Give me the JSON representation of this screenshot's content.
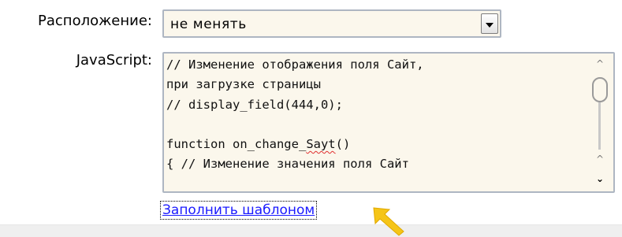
{
  "form": {
    "location_label": "Расположение:",
    "location_value": "не менять",
    "javascript_label": "JavaScript:",
    "code_lines": [
      "// Изменение отображения поля Сайт,",
      "при загрузке страницы",
      "// display_field(444,0);",
      "",
      "function on_change_Sayt()",
      "{ // Изменение значения поля Сайт"
    ],
    "fill_template_link": "Заполнить шаблоном"
  },
  "icons": {
    "select_arrow": "chevron-down-icon",
    "scroll_up": "arrow-up-icon",
    "scroll_down": "arrow-down-icon",
    "pointer": "yellow-arrow-icon"
  },
  "colors": {
    "field_background": "#fbf7ec",
    "field_border": "#aeb6c2",
    "link": "#1a1aff",
    "pointer_arrow": "#f5c518"
  }
}
